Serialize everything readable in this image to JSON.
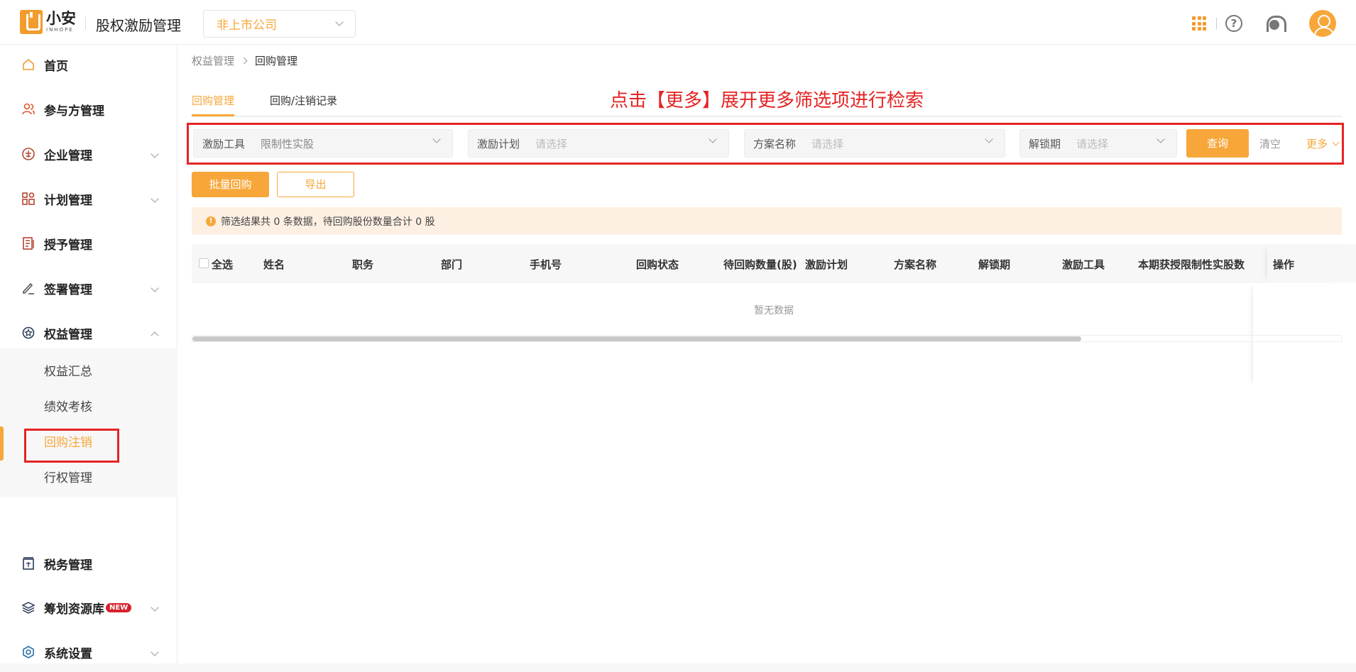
{
  "header": {
    "logo_cn": "小安",
    "logo_en": "INHOPE",
    "app_title": "股权激励管理",
    "company_select": "非上市公司"
  },
  "sidebar": {
    "items": [
      {
        "label": "首页",
        "icon": "home-icon"
      },
      {
        "label": "参与方管理",
        "icon": "users-icon"
      },
      {
        "label": "企业管理",
        "icon": "enterprise-icon"
      },
      {
        "label": "计划管理",
        "icon": "plan-icon"
      },
      {
        "label": "授予管理",
        "icon": "grant-icon"
      },
      {
        "label": "签署管理",
        "icon": "sign-icon"
      },
      {
        "label": "权益管理",
        "icon": "equity-icon"
      },
      {
        "label": "税务管理",
        "icon": "tax-icon"
      },
      {
        "label": "筹划资源库",
        "icon": "layers-icon",
        "badge": "NEW"
      },
      {
        "label": "系统设置",
        "icon": "settings-icon"
      }
    ],
    "sub_items": [
      "权益汇总",
      "绩效考核",
      "回购注销",
      "行权管理"
    ]
  },
  "breadcrumb": [
    "权益管理",
    "回购管理"
  ],
  "tabs": [
    "回购管理",
    "回购/注销记录"
  ],
  "annotation": "点击【更多】展开更多筛选项进行检索",
  "filters": [
    {
      "label": "激励工具",
      "value": "限制性实股"
    },
    {
      "label": "激励计划",
      "placeholder": "请选择"
    },
    {
      "label": "方案名称",
      "placeholder": "请选择"
    },
    {
      "label": "解锁期",
      "placeholder": "请选择"
    }
  ],
  "actions": {
    "query": "查询",
    "clear": "清空",
    "more": "更多",
    "batch_buyback": "批量回购",
    "export": "导出"
  },
  "notice": "筛选结果共 0 条数据，待回购股份数量合计 0 股",
  "table": {
    "columns": [
      "全选",
      "姓名",
      "职务",
      "部门",
      "手机号",
      "回购状态",
      "待回购数量(股)",
      "激励计划",
      "方案名称",
      "解锁期",
      "激励工具",
      "本期获授限制性实股数",
      "操作"
    ],
    "empty_text": "暂无数据"
  },
  "colors": {
    "accent": "#f7a73a",
    "annotation_red": "#e52424"
  }
}
